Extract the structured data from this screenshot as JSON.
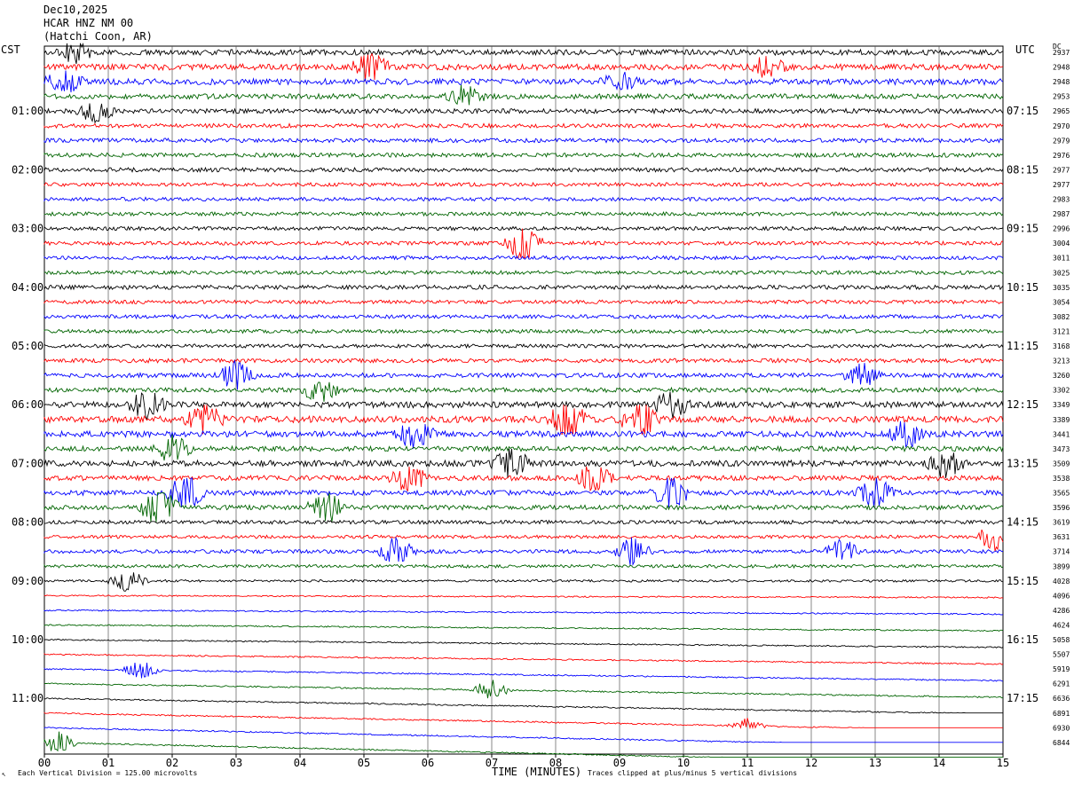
{
  "header": {
    "date": "Dec10,2025",
    "station": "HCAR HNZ NM 00",
    "location": "(Hatchi Coon, AR)"
  },
  "left_axis_label": "CST",
  "right_axis_label": "UTC",
  "dc_label": "DC",
  "footer": {
    "vertical_division": "Each Vertical Division =  125.00 microvolts",
    "xlabel": "TIME (MINUTES)",
    "clip_note": "Traces clipped at plus/minus 5 vertical divisions"
  },
  "colors": {
    "trace_cycle": [
      "#000000",
      "#ff0000",
      "#0000ff",
      "#006400"
    ],
    "grid": "#000000"
  },
  "chart_data": {
    "type": "line",
    "title": "Dec10,2025 HCAR HNZ NM 00 (Hatchi Coon, AR)",
    "xlabel": "TIME (MINUTES)",
    "xlim": [
      0,
      15
    ],
    "x_ticks": [
      "00",
      "01",
      "02",
      "03",
      "04",
      "05",
      "06",
      "07",
      "08",
      "09",
      "10",
      "11",
      "12",
      "13",
      "14",
      "15"
    ],
    "rows_per_hour": 4,
    "row_count": 48,
    "left_time_labels": [
      {
        "row": 4,
        "label": "01:00"
      },
      {
        "row": 8,
        "label": "02:00"
      },
      {
        "row": 12,
        "label": "03:00"
      },
      {
        "row": 16,
        "label": "04:00"
      },
      {
        "row": 20,
        "label": "05:00"
      },
      {
        "row": 24,
        "label": "06:00"
      },
      {
        "row": 28,
        "label": "07:00"
      },
      {
        "row": 32,
        "label": "08:00"
      },
      {
        "row": 36,
        "label": "09:00"
      },
      {
        "row": 40,
        "label": "10:00"
      },
      {
        "row": 44,
        "label": "11:00"
      }
    ],
    "right_time_labels": [
      {
        "row": 4,
        "label": "07:15"
      },
      {
        "row": 8,
        "label": "08:15"
      },
      {
        "row": 12,
        "label": "09:15"
      },
      {
        "row": 16,
        "label": "10:15"
      },
      {
        "row": 20,
        "label": "11:15"
      },
      {
        "row": 24,
        "label": "12:15"
      },
      {
        "row": 28,
        "label": "13:15"
      },
      {
        "row": 32,
        "label": "14:15"
      },
      {
        "row": 36,
        "label": "15:15"
      },
      {
        "row": 40,
        "label": "16:15"
      },
      {
        "row": 44,
        "label": "17:15"
      }
    ],
    "dc_values": [
      "2937",
      "2948",
      "2948",
      "2953",
      "2965",
      "2970",
      "2979",
      "2976",
      "2977",
      "2977",
      "2983",
      "2987",
      "2996",
      "3004",
      "3011",
      "3025",
      "3035",
      "3054",
      "3082",
      "3121",
      "3168",
      "3213",
      "3260",
      "3302",
      "3349",
      "3389",
      "3441",
      "3473",
      "3509",
      "3538",
      "3565",
      "3596",
      "3619",
      "3631",
      "3714",
      "3899",
      "4028",
      "4096",
      "4286",
      "4624",
      "5058",
      "5507",
      "5919",
      "6291",
      "6636",
      "6891",
      "6930",
      "6844"
    ],
    "row_noise_level": [
      1.2,
      1.3,
      1.3,
      1.1,
      1.0,
      0.9,
      0.9,
      0.9,
      0.9,
      0.8,
      0.8,
      0.8,
      0.8,
      0.8,
      0.8,
      0.8,
      0.9,
      0.8,
      0.8,
      0.8,
      0.8,
      0.9,
      1.0,
      1.0,
      1.3,
      1.4,
      1.3,
      1.1,
      1.3,
      1.1,
      1.1,
      1.0,
      0.8,
      0.7,
      0.8,
      0.7,
      0.5,
      0.3,
      0.3,
      0.3,
      0.3,
      0.3,
      0.3,
      0.3,
      0.3,
      0.3,
      0.3,
      0.3
    ],
    "events": [
      {
        "row": 0,
        "minute": 0.5,
        "amp": 1.5
      },
      {
        "row": 1,
        "minute": 5.1,
        "amp": 2.0
      },
      {
        "row": 1,
        "minute": 11.3,
        "amp": 1.6
      },
      {
        "row": 2,
        "minute": 0.3,
        "amp": 1.8
      },
      {
        "row": 2,
        "minute": 9.0,
        "amp": 1.2
      },
      {
        "row": 3,
        "minute": 6.6,
        "amp": 1.6
      },
      {
        "row": 4,
        "minute": 0.8,
        "amp": 1.5
      },
      {
        "row": 13,
        "minute": 7.5,
        "amp": 3.0
      },
      {
        "row": 22,
        "minute": 3.0,
        "amp": 2.0
      },
      {
        "row": 22,
        "minute": 12.8,
        "amp": 1.6
      },
      {
        "row": 23,
        "minute": 4.3,
        "amp": 1.8
      },
      {
        "row": 24,
        "minute": 1.6,
        "amp": 2.0
      },
      {
        "row": 24,
        "minute": 9.8,
        "amp": 1.8
      },
      {
        "row": 25,
        "minute": 2.5,
        "amp": 2.4
      },
      {
        "row": 25,
        "minute": 8.2,
        "amp": 3.0
      },
      {
        "row": 25,
        "minute": 9.3,
        "amp": 2.8
      },
      {
        "row": 26,
        "minute": 5.8,
        "amp": 2.2
      },
      {
        "row": 26,
        "minute": 13.5,
        "amp": 2.0
      },
      {
        "row": 27,
        "minute": 2.0,
        "amp": 2.0
      },
      {
        "row": 28,
        "minute": 7.3,
        "amp": 2.2
      },
      {
        "row": 28,
        "minute": 14.1,
        "amp": 2.0
      },
      {
        "row": 29,
        "minute": 5.7,
        "amp": 2.0
      },
      {
        "row": 29,
        "minute": 8.6,
        "amp": 2.0
      },
      {
        "row": 30,
        "minute": 2.2,
        "amp": 2.6
      },
      {
        "row": 30,
        "minute": 9.8,
        "amp": 2.4
      },
      {
        "row": 30,
        "minute": 13.0,
        "amp": 2.6
      },
      {
        "row": 31,
        "minute": 1.8,
        "amp": 3.2
      },
      {
        "row": 31,
        "minute": 4.4,
        "amp": 2.4
      },
      {
        "row": 33,
        "minute": 14.9,
        "amp": 2.4
      },
      {
        "row": 34,
        "minute": 5.5,
        "amp": 2.0
      },
      {
        "row": 34,
        "minute": 9.2,
        "amp": 1.8
      },
      {
        "row": 34,
        "minute": 12.5,
        "amp": 1.8
      },
      {
        "row": 36,
        "minute": 1.3,
        "amp": 1.6
      },
      {
        "row": 42,
        "minute": 1.5,
        "amp": 1.4
      },
      {
        "row": 43,
        "minute": 7.0,
        "amp": 1.6
      },
      {
        "row": 47,
        "minute": 0.2,
        "amp": 1.6
      },
      {
        "row": 45,
        "minute": 11.0,
        "amp": 1.0
      }
    ]
  }
}
